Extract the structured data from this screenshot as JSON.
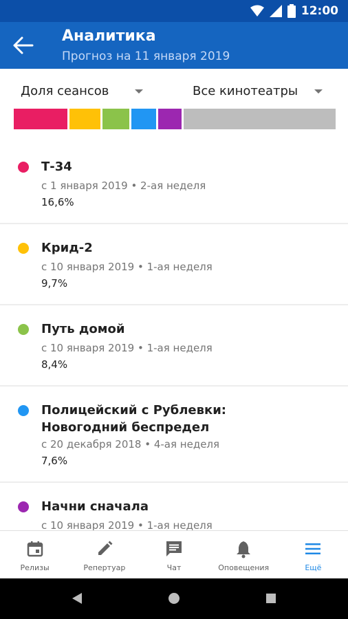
{
  "status_bar": {
    "time": "12:00"
  },
  "app_bar": {
    "title": "Аналитика",
    "subtitle": "Прогноз на 11 января 2019"
  },
  "filters": {
    "metric": "Доля сеансов",
    "cinemas": "Все кинотеатры"
  },
  "share_bar": [
    {
      "color": "#e91e63",
      "value": 16.6
    },
    {
      "color": "#ffc107",
      "value": 9.7
    },
    {
      "color": "#8bc34a",
      "value": 8.4
    },
    {
      "color": "#2196f3",
      "value": 7.6
    },
    {
      "color": "#9c27b0",
      "value": 7.2
    },
    {
      "color": "#bdbdbd",
      "value": 50.5
    }
  ],
  "items": [
    {
      "title": "Т-34",
      "meta": "с 1 января 2019 • 2-ая неделя",
      "value": "16,6%",
      "color": "#e91e63"
    },
    {
      "title": "Крид-2",
      "meta": "с 10 января 2019 • 1-ая неделя",
      "value": "9,7%",
      "color": "#ffc107"
    },
    {
      "title": "Путь домой",
      "meta": "с 10 января 2019 • 1-ая неделя",
      "value": "8,4%",
      "color": "#8bc34a"
    },
    {
      "title": "Полицейский с Рублевки: Новогодний беспредел",
      "meta": "с 20 декабря 2018 • 4-ая неделя",
      "value": "7,6%",
      "color": "#2196f3"
    },
    {
      "title": "Начни сначала",
      "meta": "с 10 января 2019 • 1-ая неделя",
      "value": "",
      "color": "#9c27b0"
    }
  ],
  "bottom_nav": [
    {
      "label": "Релизы",
      "icon": "calendar-icon"
    },
    {
      "label": "Репертуар",
      "icon": "pencil-icon"
    },
    {
      "label": "Чат",
      "icon": "chat-icon"
    },
    {
      "label": "Оповещения",
      "icon": "bell-icon"
    },
    {
      "label": "Ещё",
      "icon": "menu-icon",
      "active": true
    }
  ],
  "colors": {
    "primary": "#1565c0",
    "status_bar": "#0c4fa8",
    "active": "#1e88e5"
  }
}
